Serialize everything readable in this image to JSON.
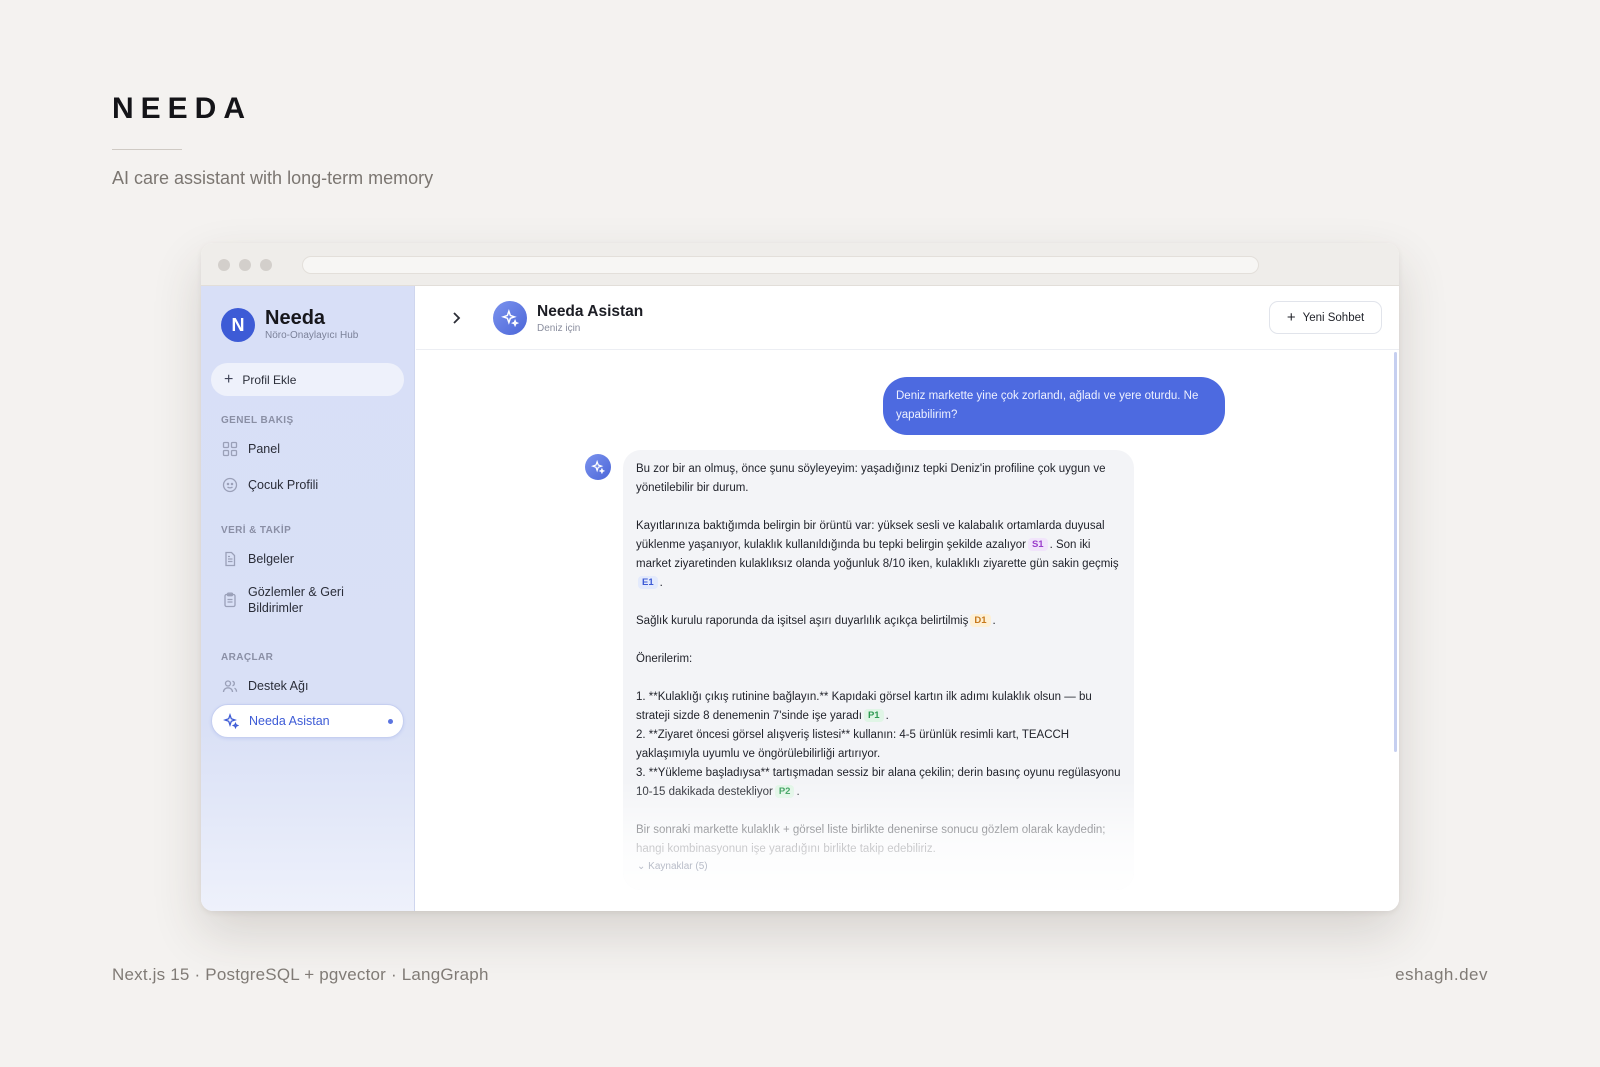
{
  "page": {
    "title": "NEEDA",
    "subtitle": "AI care assistant with long-term memory",
    "footer_left": "Next.js 15 · PostgreSQL + pgvector · LangGraph",
    "footer_right": "eshagh.dev"
  },
  "sidebar": {
    "logo_initial": "N",
    "logo_name": "Needa",
    "logo_tagline": "Nöro-Onaylayıcı Hub",
    "add_profile_label": "Profil Ekle",
    "sections": [
      {
        "label": "GENEL BAKIŞ",
        "items": [
          {
            "label": "Panel",
            "icon": "grid-icon"
          },
          {
            "label": "Çocuk Profili",
            "icon": "child-face-icon"
          }
        ]
      },
      {
        "label": "VERİ & TAKİP",
        "items": [
          {
            "label": "Belgeler",
            "icon": "document-icon"
          },
          {
            "label": "Gözlemler & Geri Bildirimler",
            "icon": "clipboard-icon"
          }
        ]
      },
      {
        "label": "ARAÇLAR",
        "items": [
          {
            "label": "Destek Ağı",
            "icon": "users-icon"
          },
          {
            "label": "Needa Asistan",
            "icon": "sparkle-icon",
            "active": true
          }
        ]
      }
    ]
  },
  "header": {
    "assistant_name": "Needa Asistan",
    "assistant_sub": "Deniz için",
    "new_chat_label": "Yeni Sohbet"
  },
  "chat": {
    "user_message": "Deniz markette yine çok zorlandı, ağladı ve yere oturdu. Ne yapabilirim?",
    "reply": {
      "p1": "Bu zor bir an olmuş, önce şunu söyleyeyim: yaşadığınız tepki Deniz'in profiline çok uygun ve yönetilebilir bir durum.",
      "p2a": "Kayıtlarınıza baktığımda belirgin bir örüntü var: yüksek sesli ve kalabalık ortamlarda duyusal yüklenme yaşanıyor, kulaklık kullanıldığında bu tepki belirgin şekilde azalıyor",
      "chip_s1": "S1",
      "p2b": ". Son iki market ziyaretinden kulaklıksız olanda yoğunluk 8/10 iken, kulaklıklı ziyarette gün sakin geçmiş",
      "chip_e1": "E1",
      "p2c": ".",
      "p3a": "Sağlık kurulu raporunda da işitsel aşırı duyarlılık açıkça belirtilmiş",
      "chip_d1": "D1",
      "p3b": ".",
      "p4": "Önerilerim:",
      "l1a": "1. **Kulaklığı çıkış rutinine bağlayın.** Kapıdaki görsel kartın ilk adımı kulaklık olsun — bu strateji sizde 8 denemenin 7'sinde işe yaradı",
      "chip_p1": "P1",
      "l1b": ".",
      "l2": "2. **Ziyaret öncesi görsel alışveriş listesi** kullanın: 4-5 ürünlük resimli kart, TEACCH yaklaşımıyla uyumlu ve öngörülebilirliği artırıyor.",
      "l3a": "3. **Yükleme başladıysa** tartışmadan sessiz bir alana çekilin; derin basınç oyunu regülasyonu 10-15 dakikada destekliyor",
      "chip_p2": "P2",
      "l3b": ".",
      "p5": "Bir sonraki markette kulaklık + görsel liste birlikte denenirse sonucu gözlem olarak kaydedin; hangi kombinasyonun işe yaradığını birlikte takip edebiliriz.",
      "sources_label": "Kaynaklar (5)"
    }
  },
  "colors": {
    "accent": "#4d6ae0",
    "sidebar_bg": "#d8dff7",
    "page_bg": "#f4f2f0"
  }
}
